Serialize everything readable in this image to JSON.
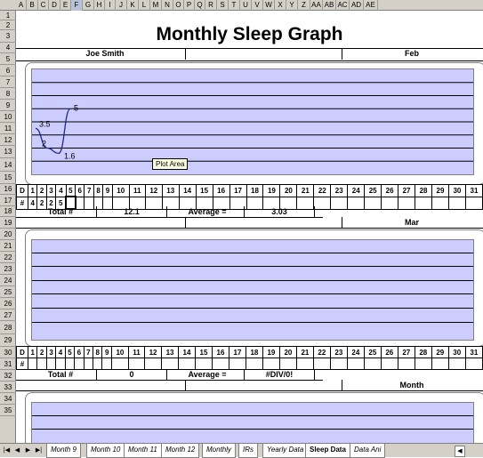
{
  "columns": [
    "A",
    "B",
    "C",
    "D",
    "E",
    "F",
    "G",
    "H",
    "I",
    "J",
    "K",
    "L",
    "M",
    "N",
    "O",
    "P",
    "Q",
    "R",
    "S",
    "T",
    "U",
    "V",
    "W",
    "X",
    "Y",
    "Z",
    "AA",
    "AB",
    "AC",
    "AD",
    "AE",
    "AF"
  ],
  "active_column": "F",
  "rows": [
    "1",
    "2",
    "3",
    "4",
    "5",
    "6",
    "7",
    "8",
    "9",
    "10",
    "11",
    "12",
    "13",
    "14",
    "15",
    "16",
    "17",
    "18",
    "19",
    "20",
    "21",
    "22",
    "23",
    "24",
    "25",
    "26",
    "27",
    "28",
    "29",
    "30",
    "31",
    "32",
    "33",
    "34",
    "35"
  ],
  "sheet": {
    "title": "Monthly Sleep Graph",
    "name": "Joe Smith",
    "month1": "Feb",
    "month2": "Mar",
    "month3": "Month"
  },
  "chart1": {
    "tooltip": "Plot Area",
    "point_labels": [
      "3.5",
      "2",
      "1.6",
      "5"
    ]
  },
  "chart_data": {
    "type": "line",
    "categories": [
      "1",
      "2",
      "3",
      "4"
    ],
    "values": [
      3.5,
      2,
      1.6,
      5
    ],
    "ylim": [
      0,
      8
    ],
    "grid": true
  },
  "days": [
    "1",
    "2",
    "3",
    "4",
    "5",
    "6",
    "7",
    "8",
    "9",
    "10",
    "11",
    "12",
    "13",
    "14",
    "15",
    "16",
    "17",
    "18",
    "19",
    "20",
    "21",
    "22",
    "23",
    "24",
    "25",
    "26",
    "27",
    "28",
    "29",
    "30",
    "31"
  ],
  "block1": {
    "day_label": "D",
    "hours_label": "#",
    "hours": [
      "4",
      "2",
      "2",
      "5"
    ],
    "total_label": "Total #",
    "total_value": "12.1",
    "average_label": "Average =",
    "average_value": "3.03"
  },
  "block2": {
    "day_label": "D",
    "hours_label": "#",
    "total_label": "Total #",
    "total_value": "0",
    "average_label": "Average =",
    "average_value": "#DIV/0!"
  },
  "tabs": [
    "Month 9",
    "Month 10",
    "Month 11",
    "Month 12",
    "Monthly",
    "IRs",
    "Yearly Data",
    "Sleep Data",
    "Data Ani"
  ],
  "active_tab": "Sleep Data"
}
